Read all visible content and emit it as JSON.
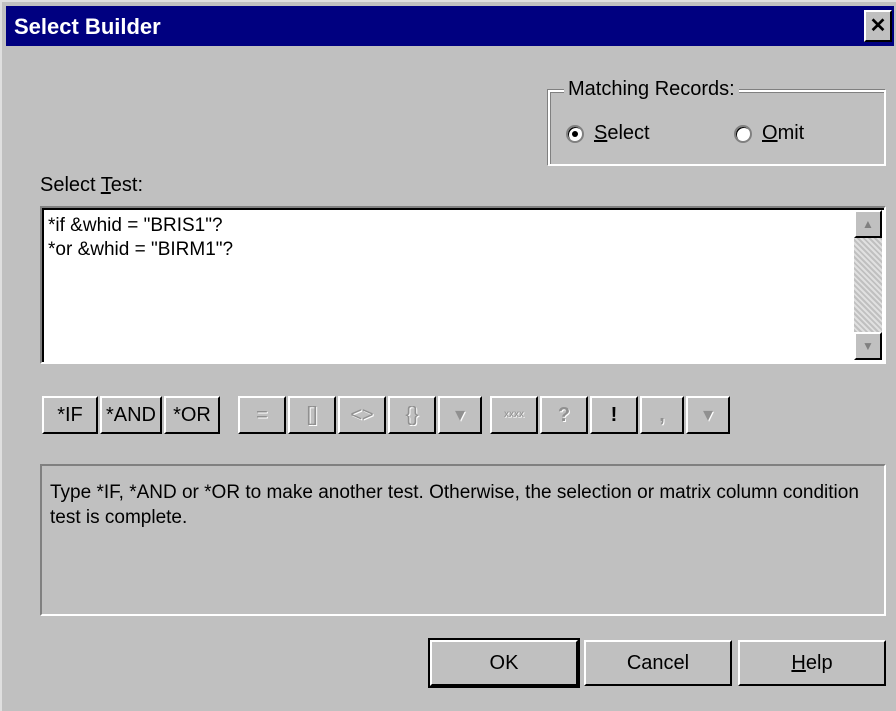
{
  "window": {
    "title": "Select Builder",
    "close_label": "✕"
  },
  "matching": {
    "legend": "Matching Records:",
    "select_label": "Select",
    "select_rest": "elect",
    "select_key": "S",
    "omit_key": "O",
    "omit_rest": "mit",
    "selected": "Select"
  },
  "select_test": {
    "label_pre": "Select ",
    "label_key": "T",
    "label_post": "est:",
    "lines": [
      "*if &whid = \"BRIS1\"?",
      "*or &whid = \"BIRM1\"?"
    ]
  },
  "toolbar": {
    "if": "*IF",
    "and": "*AND",
    "or": "*OR",
    "eq": "=",
    "brackets": "[]",
    "angles": "<>",
    "braces": "{}",
    "dropdown1": "▾",
    "xxxx": "xxxx",
    "question": "?",
    "exclaim": "!",
    "comma": ",",
    "dropdown2": "▾"
  },
  "hint": "Type *IF, *AND or *OR to make another test.  Otherwise, the selection or matrix column condition test is complete.",
  "buttons": {
    "ok": "OK",
    "cancel": "Cancel",
    "help_key": "H",
    "help_rest": "elp"
  },
  "icons": {
    "close": "close-icon",
    "scroll_up": "scroll-up-icon",
    "scroll_down": "scroll-down-icon"
  }
}
